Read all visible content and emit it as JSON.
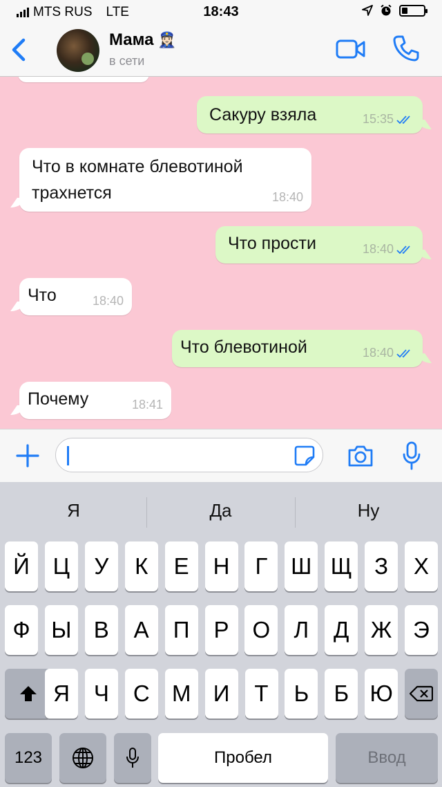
{
  "status_bar": {
    "carrier": "MTS RUS",
    "network": "LTE",
    "time": "18:43",
    "battery_level": 0.25
  },
  "header": {
    "contact_name": "Мама",
    "contact_emoji": "👮🏻‍♀️",
    "presence": "в сети"
  },
  "messages": [
    {
      "side": "out",
      "text": "Сакуру взяла",
      "time": "15:35",
      "read": true
    },
    {
      "side": "in",
      "text": "Что в комнате блевотиной\nтрахнется",
      "time": "18:40"
    },
    {
      "side": "out",
      "text": "Что прости",
      "time": "18:40",
      "read": true
    },
    {
      "side": "in",
      "text": "Что",
      "time": "18:40"
    },
    {
      "side": "out",
      "text": "Что блевотиной",
      "time": "18:40",
      "read": true
    },
    {
      "side": "in",
      "text": "Почему",
      "time": "18:41"
    }
  ],
  "composer": {
    "value": ""
  },
  "keyboard": {
    "suggestions": [
      "Я",
      "Да",
      "Ну"
    ],
    "row1": [
      "Й",
      "Ц",
      "У",
      "К",
      "Е",
      "Н",
      "Г",
      "Ш",
      "Щ",
      "З",
      "Х"
    ],
    "row2": [
      "Ф",
      "Ы",
      "В",
      "А",
      "П",
      "Р",
      "О",
      "Л",
      "Д",
      "Ж",
      "Э"
    ],
    "row3": [
      "Я",
      "Ч",
      "С",
      "М",
      "И",
      "Т",
      "Ь",
      "Б",
      "Ю"
    ],
    "numbers_key": "123",
    "space_key": "Пробел",
    "return_key": "Ввод"
  },
  "colors": {
    "accent": "#1f7cf6",
    "chat_background": "#fbc8d4",
    "outgoing_bubble": "#dcf8c6",
    "incoming_bubble": "#ffffff"
  },
  "icons": [
    "signal-icon",
    "location-arrow-icon",
    "alarm-icon",
    "battery-icon",
    "back-chevron-icon",
    "video-call-icon",
    "phone-icon",
    "plus-icon",
    "sticker-icon",
    "camera-icon",
    "microphone-icon",
    "read-checkmarks-icon",
    "shift-icon",
    "backspace-icon",
    "globe-icon"
  ]
}
